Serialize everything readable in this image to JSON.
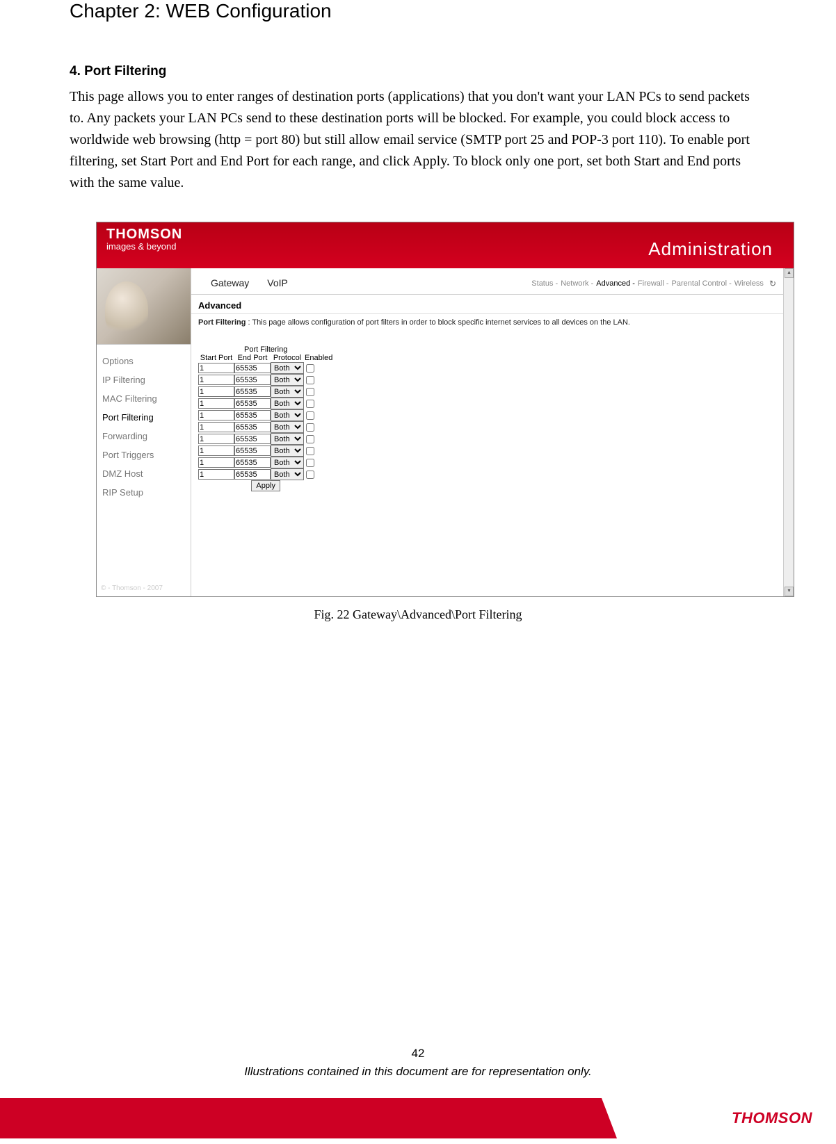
{
  "chapter_title": "Chapter 2: WEB Configuration",
  "section": {
    "number_title": "4. Port Filtering",
    "body": "This page allows you to enter ranges of destination ports (applications) that you don't want your LAN PCs to send packets to. Any packets your LAN PCs send to these destination ports will be blocked. For example, you could block access to worldwide web browsing (http = port 80) but still allow email service (SMTP port 25 and POP-3 port 110). To enable port filtering, set Start Port and End Port for each range, and click Apply. To block only one port, set both Start and End ports with the same value."
  },
  "screenshot": {
    "banner": {
      "brand": "THOMSON",
      "tag": "images & beyond",
      "right": "Administration"
    },
    "sidebar": {
      "items": [
        {
          "label": "Options",
          "active": false
        },
        {
          "label": "IP Filtering",
          "active": false
        },
        {
          "label": "MAC Filtering",
          "active": false
        },
        {
          "label": "Port Filtering",
          "active": true
        },
        {
          "label": "Forwarding",
          "active": false
        },
        {
          "label": "Port Triggers",
          "active": false
        },
        {
          "label": "DMZ Host",
          "active": false
        },
        {
          "label": "RIP Setup",
          "active": false
        }
      ],
      "copyright": "© - Thomson - 2007"
    },
    "tabs": {
      "main": [
        "Gateway",
        "VoIP"
      ],
      "sub": [
        {
          "label": "Status -",
          "active": false
        },
        {
          "label": "Network -",
          "active": false
        },
        {
          "label": "Advanced -",
          "active": true
        },
        {
          "label": "Firewall -",
          "active": false
        },
        {
          "label": "Parental Control -",
          "active": false
        },
        {
          "label": "Wireless",
          "active": false
        }
      ]
    },
    "section_head": "Advanced",
    "desc_label": "Port Filtering",
    "desc_text": " :  This page allows configuration of port filters in order to block specific internet services to all devices on the LAN.",
    "table": {
      "caption": "Port Filtering",
      "headers": [
        "Start Port",
        "End Port",
        "Protocol",
        "Enabled"
      ],
      "rows": [
        {
          "start": "1",
          "end": "65535",
          "proto": "Both",
          "enabled": false
        },
        {
          "start": "1",
          "end": "65535",
          "proto": "Both",
          "enabled": false
        },
        {
          "start": "1",
          "end": "65535",
          "proto": "Both",
          "enabled": false
        },
        {
          "start": "1",
          "end": "65535",
          "proto": "Both",
          "enabled": false
        },
        {
          "start": "1",
          "end": "65535",
          "proto": "Both",
          "enabled": false
        },
        {
          "start": "1",
          "end": "65535",
          "proto": "Both",
          "enabled": false
        },
        {
          "start": "1",
          "end": "65535",
          "proto": "Both",
          "enabled": false
        },
        {
          "start": "1",
          "end": "65535",
          "proto": "Both",
          "enabled": false
        },
        {
          "start": "1",
          "end": "65535",
          "proto": "Both",
          "enabled": false
        },
        {
          "start": "1",
          "end": "65535",
          "proto": "Both",
          "enabled": false
        }
      ],
      "apply": "Apply"
    }
  },
  "figure_caption": "Fig. 22 Gateway\\Advanced\\Port Filtering",
  "footer": {
    "page": "42",
    "note": "Illustrations contained in this document are for representation only.",
    "brand": "THOMSON"
  }
}
